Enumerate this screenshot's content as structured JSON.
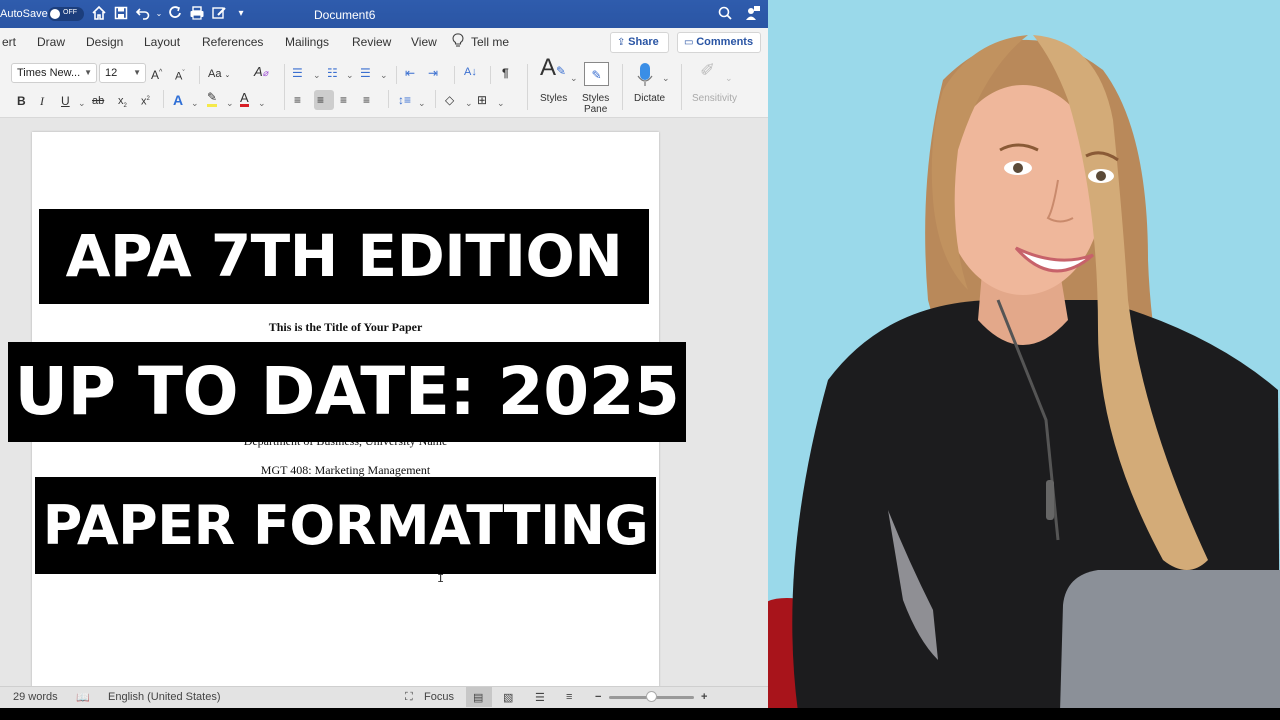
{
  "word": {
    "titlebar": {
      "autosave_label": "AutoSave",
      "autosave_state": "OFF",
      "document_title": "Document6",
      "icons": [
        "home-icon",
        "save-icon",
        "undo-icon",
        "redo-icon",
        "print-icon",
        "edit-icon",
        "customize-icon",
        "search-icon",
        "profile-icon"
      ]
    },
    "tabs": [
      {
        "label": "ert"
      },
      {
        "label": "Draw"
      },
      {
        "label": "Design"
      },
      {
        "label": "Layout"
      },
      {
        "label": "References"
      },
      {
        "label": "Mailings"
      },
      {
        "label": "Review"
      },
      {
        "label": "View"
      }
    ],
    "tell_me": "Tell me",
    "share_label": "Share",
    "comments_label": "Comments",
    "ribbon": {
      "font_name": "Times New...",
      "font_size": "12",
      "change_case": "Aa",
      "styles_label": "Styles",
      "styles_pane_label": "Styles\nPane",
      "dictate_label": "Dictate",
      "sensitivity_label": "Sensitivity",
      "text_color": "#d81f26",
      "highlight_color": "#f5e94a",
      "text_effects_color": "#2f6fd6"
    },
    "document": {
      "lines": [
        "This is the Title of Your Paper",
        "Department of Business, University Name",
        "MGT 408: Marketing Management"
      ]
    },
    "statusbar": {
      "word_count": "29 words",
      "language": "English (United States)",
      "focus_label": "Focus",
      "zoom_level_fraction": 0.5
    }
  },
  "overlay": {
    "banner1": "APA 7TH EDITION",
    "banner2": "UP TO DATE: 2025",
    "banner3": "PAPER FORMATTING"
  },
  "presenter": {
    "background_color": "#9ad9ea",
    "description": "Smiling woman with long blonde hair in black quarter-zip top, seated at laptop"
  }
}
